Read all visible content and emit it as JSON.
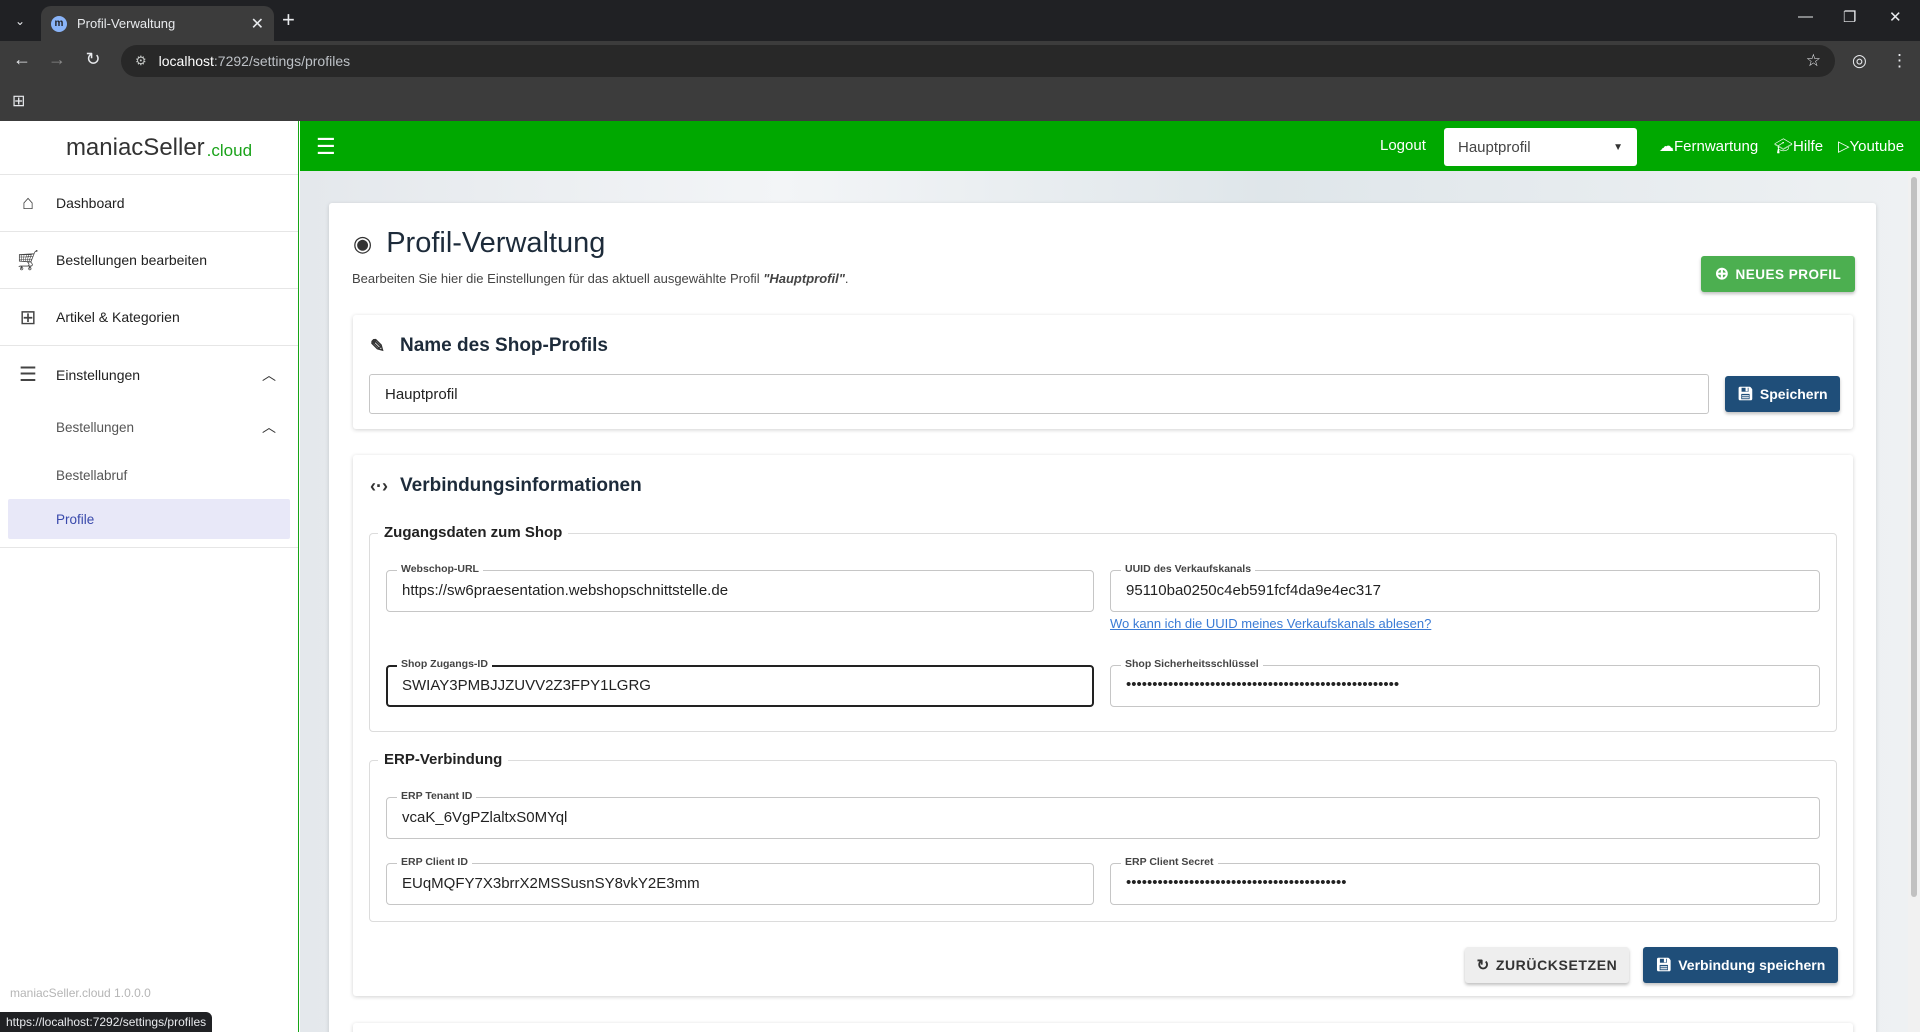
{
  "browser": {
    "tab_title": "Profil-Verwaltung",
    "url_host": "localhost",
    "url_path": ":7292/settings/profiles",
    "status_url": "https://localhost:7292/settings/profiles"
  },
  "sidebar": {
    "logo_main": "maniacSeller",
    "logo_suffix": ".cloud",
    "items": [
      {
        "label": "Dashboard",
        "icon": "home-icon"
      },
      {
        "label": "Bestellungen bearbeiten",
        "icon": "cart-icon"
      },
      {
        "label": "Artikel & Kategorien",
        "icon": "add-to-screen-icon"
      },
      {
        "label": "Einstellungen",
        "icon": "tune-icon"
      }
    ],
    "sub_items": [
      {
        "label": "Bestellungen"
      },
      {
        "label": "Bestellabruf"
      },
      {
        "label": "Profile"
      }
    ],
    "version": "maniacSeller.cloud 1.0.0.0"
  },
  "topbar": {
    "logout": "Logout",
    "profile_selected": "Hauptprofil",
    "links": [
      "Fernwartung",
      "Hilfe",
      "Youtube"
    ]
  },
  "page": {
    "title": "Profil-Verwaltung",
    "subtitle_prefix": "Bearbeiten Sie hier die Einstellungen für das aktuell ausgewählte Profil ",
    "subtitle_profile": "\"Hauptprofil\"",
    "subtitle_suffix": ".",
    "new_profile_button": "NEUES PROFIL"
  },
  "name_section": {
    "title": "Name des Shop-Profils",
    "value": "Hauptprofil",
    "save_button": "Speichern"
  },
  "connection_section": {
    "title": "Verbindungsinformationen",
    "shop_group": "Zugangsdaten zum Shop",
    "webshop_url_label": "Webschop-URL",
    "webshop_url": "https://sw6praesentation.webshopschnittstelle.de",
    "uuid_label": "UUID des Verkaufskanals",
    "uuid": "95110ba0250c4eb591fcf4da9e4ec317",
    "uuid_help": "Wo kann ich die UUID meines Verkaufskanals ablesen?",
    "access_id_label": "Shop Zugangs-ID",
    "access_id": "SWIAY3PMBJJZUVV2Z3FPY1LGRG",
    "secret_label": "Shop Sicherheitsschlüssel",
    "secret": "••••••••••••••••••••••••••••••••••••••••••••••••••••",
    "erp_group": "ERP-Verbindung",
    "tenant_label": "ERP Tenant ID",
    "tenant": "vcaK_6VgPZlaltxS0MYql",
    "client_id_label": "ERP Client ID",
    "client_id": "EUqMQFY7X3brrX2MSSusnSY8vkY2E3mm",
    "client_secret_label": "ERP Client Secret",
    "client_secret": "••••••••••••••••••••••••••••••••••••••••••",
    "reset_button": "ZURÜCKSETZEN",
    "save_button": "Verbindung speichern"
  }
}
